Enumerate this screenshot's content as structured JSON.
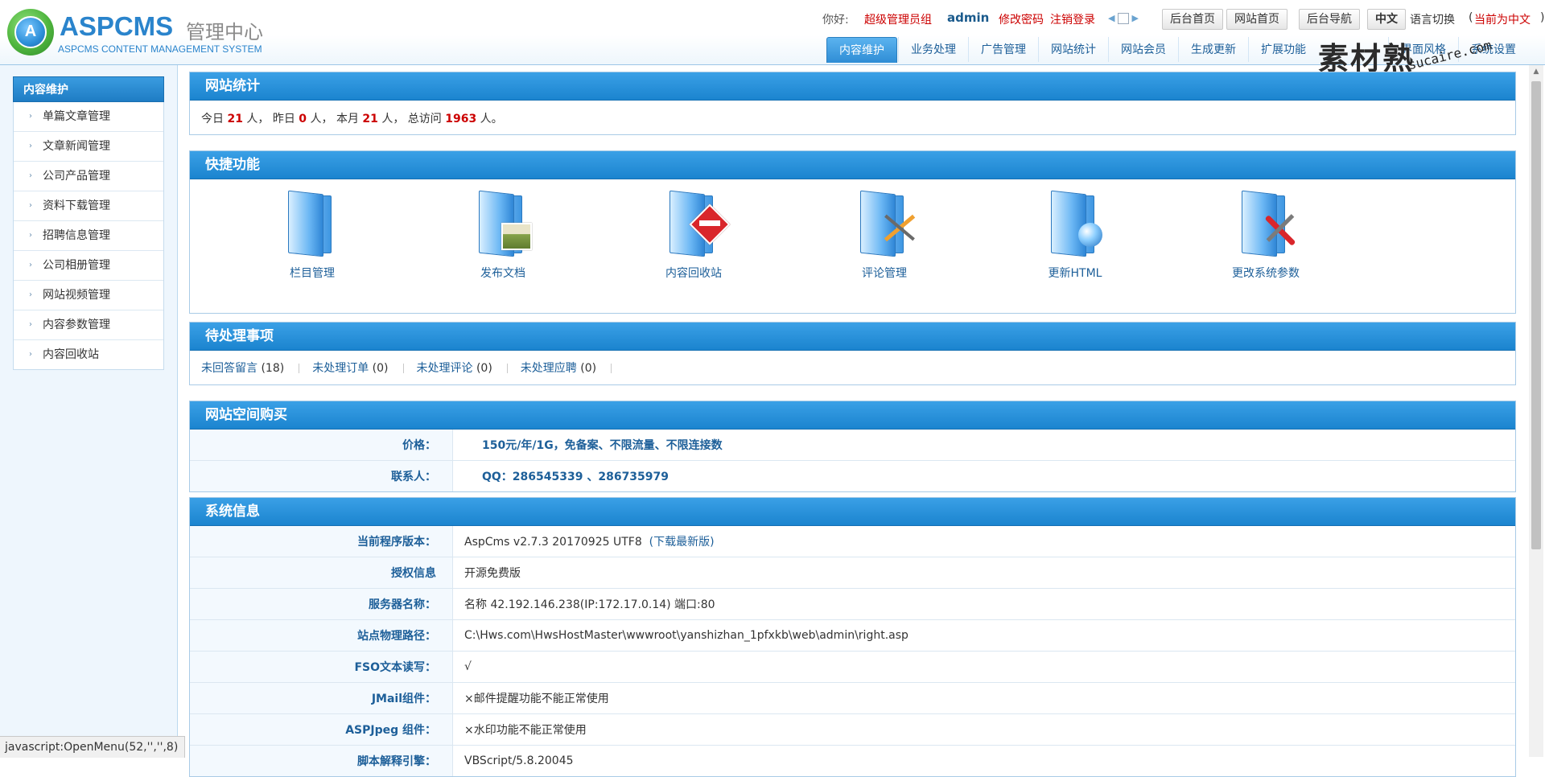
{
  "header": {
    "logo_title": "ASPCMS",
    "logo_subtitle": "管理中心",
    "logo_english": "ASPCMS CONTENT MANAGEMENT SYSTEM",
    "logo_mark": "A",
    "greeting": "你好:",
    "role": "超级管理员组",
    "username": "admin",
    "change_password": "修改密码",
    "logout": "注销登录",
    "buttons": [
      "后台首页",
      "网站首页",
      "后台导航",
      "中文"
    ],
    "language_label": "语言切换",
    "language_current_prefix": "(",
    "language_current": "当前为中文",
    "language_current_suffix": ")"
  },
  "nav_tabs": [
    "内容维护",
    "业务处理",
    "广告管理",
    "网站统计",
    "网站会员",
    "生成更新",
    "扩展功能",
    "界面风格",
    "系统设置"
  ],
  "watermark": {
    "text_cn": "素材熟",
    "text_en": "sucaire.com"
  },
  "sidebar": {
    "header": "内容维护",
    "items": [
      "单篇文章管理",
      "文章新闻管理",
      "公司产品管理",
      "资料下载管理",
      "招聘信息管理",
      "公司相册管理",
      "网站视频管理",
      "内容参数管理",
      "内容回收站"
    ]
  },
  "stats": {
    "title": "网站统计",
    "today_label": "今日",
    "today": "21",
    "unit1": "人，  昨日",
    "yesterday": "0",
    "unit2": "人，  本月",
    "month": "21",
    "unit3": "人，  总访问",
    "total": "1963",
    "unit4": "人。"
  },
  "quick": {
    "title": "快捷功能",
    "items": [
      {
        "label": "栏目管理",
        "icon": "folder-icon"
      },
      {
        "label": "发布文档",
        "icon": "folder-image-icon"
      },
      {
        "label": "内容回收站",
        "icon": "folder-stop-icon"
      },
      {
        "label": "评论管理",
        "icon": "folder-pencil-icon"
      },
      {
        "label": "更新HTML",
        "icon": "folder-globe-icon"
      },
      {
        "label": "更改系统参数",
        "icon": "folder-tools-icon"
      }
    ]
  },
  "pending": {
    "title": "待处理事项",
    "items": [
      {
        "label": "未回答留言",
        "count": "(18)"
      },
      {
        "label": "未处理订单",
        "count": "(0)"
      },
      {
        "label": "未处理评论",
        "count": "(0)"
      },
      {
        "label": "未处理应聘",
        "count": "(0)"
      }
    ]
  },
  "buy": {
    "title": "网站空间购买",
    "rows": [
      {
        "key": "价格：",
        "value": "150元/年/1G，免备案、不限流量、不限连接数"
      },
      {
        "key": "联系人：",
        "value": "QQ：286545339 、286735979"
      }
    ]
  },
  "sysinfo": {
    "title": "系统信息",
    "version_key": "当前程序版本：",
    "version_value": "AspCms v2.7.3 20170925 UTF8",
    "version_link": "(下载最新版)",
    "rows": [
      {
        "key": "授权信息",
        "value": "开源免费版"
      },
      {
        "key": "服务器名称：",
        "value": "名称 42.192.146.238(IP:172.17.0.14) 端口:80"
      },
      {
        "key": "站点物理路径：",
        "value": "C:\\Hws.com\\HwsHostMaster\\wwwroot\\yanshizhan_1pfxkb\\web\\admin\\right.asp"
      },
      {
        "key": "FSO文本读写：",
        "value": "√"
      }
    ],
    "warn_rows": [
      {
        "key": "JMail组件：",
        "value": "×邮件提醒功能不能正常使用"
      },
      {
        "key": "ASPJpeg 组件：",
        "value": "×水印功能不能正常使用"
      }
    ],
    "script_key": "脚本解释引擎：",
    "script_value": "VBScript/5.8.20045"
  },
  "statusbar": "javascript:OpenMenu(52,'','',8)",
  "colors": {
    "accent": "#1b84cf",
    "link": "#1d5f99",
    "alert": "#cc0000",
    "warning": "#d8206a"
  }
}
